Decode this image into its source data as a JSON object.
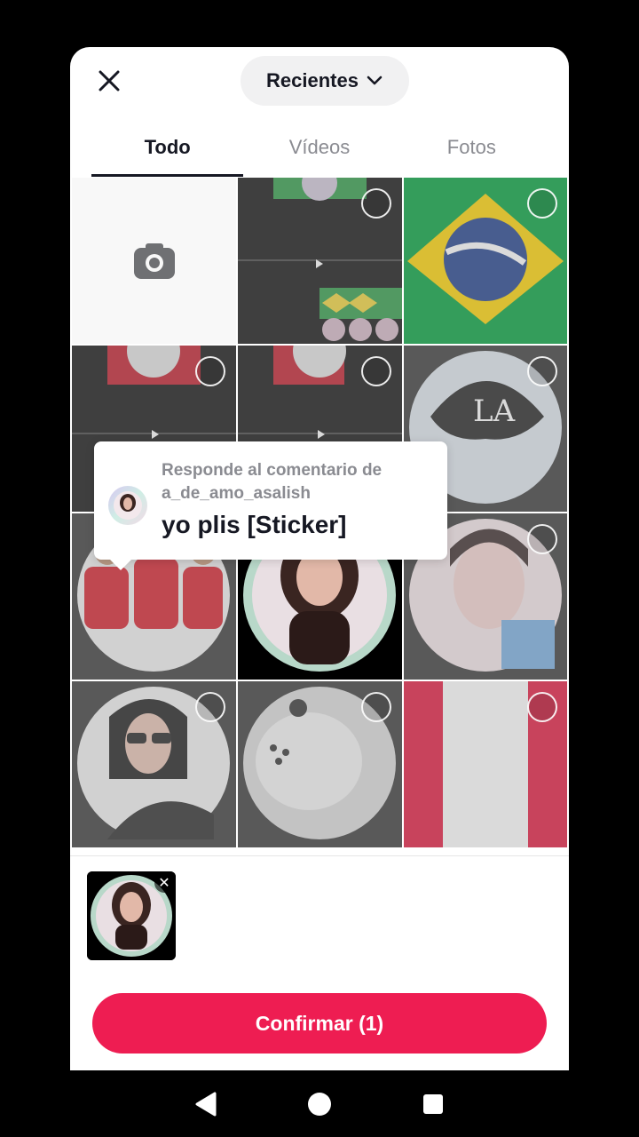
{
  "header": {
    "album_label": "Recientes",
    "close_icon": "close-icon",
    "chevron_icon": "chevron-down-icon"
  },
  "tabs": [
    {
      "label": "Todo",
      "active": true
    },
    {
      "label": "Vídeos",
      "active": false
    },
    {
      "label": "Fotos",
      "active": false
    }
  ],
  "grid": {
    "camera_icon": "camera-icon",
    "items": [
      "camera-tile",
      "video-screen-recording",
      "brazil-flag",
      "screen-recording-red",
      "screen-recording-red",
      "cap-la-circle",
      "football-players-circle",
      "girl-photo-circle-selected",
      "girl-selfie-circle",
      "girl-sunglasses-circle",
      "plush-toy-circle",
      "red-white-flag"
    ]
  },
  "tooltip": {
    "label": "Responde al comentario de a_de_amo_asalish",
    "text": "yo plis [Sticker]"
  },
  "selected_tray": {
    "count": 1,
    "remove_icon": "close-icon"
  },
  "confirm_button": {
    "label": "Confirmar (1)"
  },
  "colors": {
    "accent": "#ee1d52",
    "text": "#161823",
    "muted": "#8a8b91"
  },
  "nav": {
    "back_icon": "back-triangle-icon",
    "home_icon": "home-circle-icon",
    "recents_icon": "recents-square-icon"
  }
}
